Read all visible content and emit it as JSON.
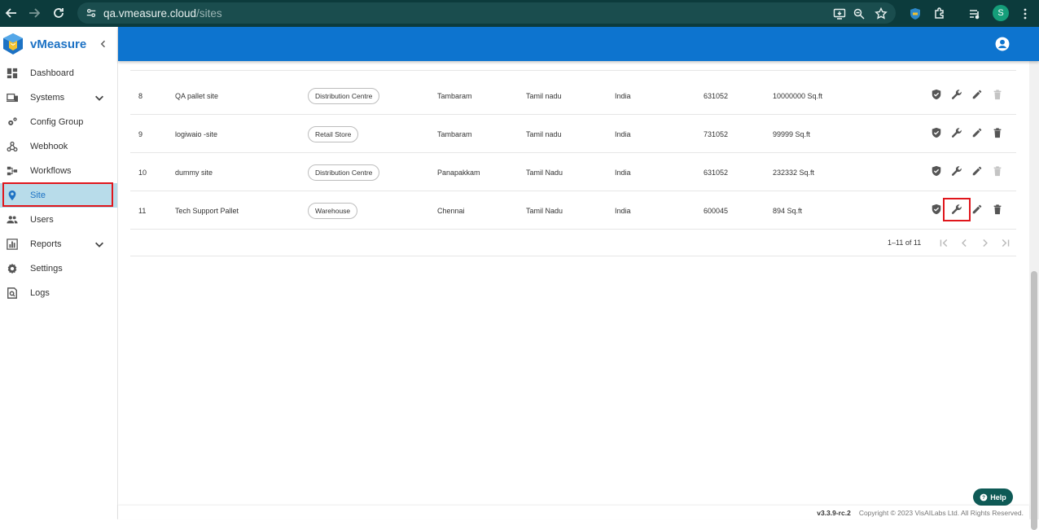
{
  "browser": {
    "url_host": "qa.vmeasure.cloud",
    "url_path": "/sites",
    "profile_initial": "S"
  },
  "sidebar": {
    "brand": "vMeasure",
    "items": [
      {
        "label": "Dashboard",
        "icon": "dashboard-icon"
      },
      {
        "label": "Systems",
        "icon": "devices-icon",
        "expandable": true
      },
      {
        "label": "Config Group",
        "icon": "gear-group-icon"
      },
      {
        "label": "Webhook",
        "icon": "webhook-icon"
      },
      {
        "label": "Workflows",
        "icon": "workflow-icon"
      },
      {
        "label": "Site",
        "icon": "location-pin-icon",
        "active": true
      },
      {
        "label": "Users",
        "icon": "users-icon"
      },
      {
        "label": "Reports",
        "icon": "reports-icon",
        "expandable": true
      },
      {
        "label": "Settings",
        "icon": "settings-icon"
      },
      {
        "label": "Logs",
        "icon": "logs-icon"
      }
    ]
  },
  "table": {
    "rows": [
      {
        "no": "8",
        "name": "QA pallet site",
        "type": "Distribution Centre",
        "city": "Tambaram",
        "state": "Tamil nadu",
        "country": "India",
        "pincode": "631052",
        "area": "10000000 Sq.ft",
        "delete_enabled": false
      },
      {
        "no": "9",
        "name": "logiwaio -site",
        "type": "Retail Store",
        "city": "Tambaram",
        "state": "Tamil nadu",
        "country": "India",
        "pincode": "731052",
        "area": "99999 Sq.ft",
        "delete_enabled": true
      },
      {
        "no": "10",
        "name": "dummy site",
        "type": "Distribution Centre",
        "city": "Panapakkam",
        "state": "Tamil Nadu",
        "country": "India",
        "pincode": "631052",
        "area": "232332 Sq.ft",
        "delete_enabled": false
      },
      {
        "no": "11",
        "name": "Tech Support Pallet",
        "type": "Warehouse",
        "city": "Chennai",
        "state": "Tamil Nadu",
        "country": "India",
        "pincode": "600045",
        "area": "894 Sq.ft",
        "delete_enabled": true
      }
    ]
  },
  "pagination": {
    "range_text": "1–11 of 11"
  },
  "footer": {
    "version": "v3.3.9-rc.2",
    "copyright": "Copyright © 2023 VisAILabs Ltd. All Rights Reserved."
  },
  "help": {
    "label": "Help"
  },
  "colors": {
    "appbar": "#0d74cf",
    "chrome": "#0c3b3c",
    "active_bg": "#b8dcea",
    "highlight": "#e0161c",
    "help": "#0e5a56"
  }
}
